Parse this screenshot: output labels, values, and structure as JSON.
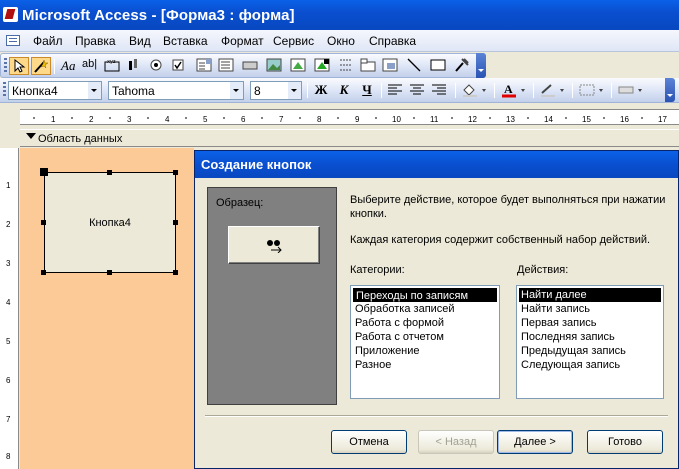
{
  "window": {
    "title": "Microsoft Access - [Форма3 : форма]"
  },
  "menu": {
    "items": [
      "Файл",
      "Правка",
      "Вид",
      "Вставка",
      "Формат",
      "Сервис",
      "Окно",
      "Справка"
    ]
  },
  "toolbox": {
    "icons": [
      "select-objects-icon",
      "control-wizards-icon",
      "label-icon",
      "textbox-icon",
      "option-group-icon",
      "toggle-button-icon",
      "option-button-icon",
      "checkbox-icon",
      "combobox-icon",
      "listbox-icon",
      "command-button-icon",
      "image-icon",
      "unbound-object-icon",
      "bound-object-icon",
      "page-break-icon",
      "tab-control-icon",
      "subform-icon",
      "line-icon",
      "rectangle-icon",
      "more-controls-icon"
    ]
  },
  "format": {
    "object": "Кнопка4",
    "font": "Tahoma",
    "size": "8",
    "bold": "Ж",
    "italic": "К",
    "underline": "Ч"
  },
  "ruler": {
    "h_ticks": [
      "1",
      "2",
      "3",
      "4",
      "5",
      "6",
      "7",
      "8",
      "9",
      "10",
      "11",
      "12",
      "13",
      "14",
      "15",
      "16",
      "17"
    ],
    "v_ticks": [
      "1",
      "2",
      "3",
      "4",
      "5",
      "6",
      "7",
      "8"
    ]
  },
  "section": {
    "label": "Область данных"
  },
  "form": {
    "button_label": "Кнопка4"
  },
  "wizard": {
    "title": "Создание кнопок",
    "sample_label": "Образец:",
    "description1": "Выберите действие, которое будет выполняться при нажатии кнопки.",
    "description2": "Каждая категория содержит собственный набор действий.",
    "categories_label": "Категории:",
    "actions_label": "Действия:",
    "categories": [
      "Переходы по записям",
      "Обработка записей",
      "Работа с формой",
      "Работа с отчетом",
      "Приложение",
      "Разное"
    ],
    "actions": [
      "Найти далее",
      "Найти запись",
      "Первая запись",
      "Последняя запись",
      "Предыдущая запись",
      "Следующая запись"
    ],
    "buttons": {
      "cancel": "Отмена",
      "back": "< Назад",
      "next": "Далее >",
      "finish": "Готово"
    }
  },
  "colors": {
    "form_bg": "#fcca96",
    "titlebar": "#0a4fd0"
  }
}
